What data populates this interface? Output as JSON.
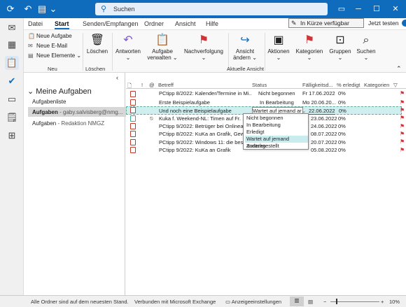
{
  "titlebar": {
    "search_placeholder": "Suchen",
    "accent": "#0f6cbd"
  },
  "menu": {
    "tabs": [
      "Datei",
      "Start",
      "Senden/Empfangen",
      "Ordner",
      "Ansicht",
      "Hilfe"
    ],
    "active": "Start",
    "kurz_label": "In Kürze verfügbar",
    "test_label": "Jetzt testen"
  },
  "ribbon": {
    "neue_aufgabe": "Neue Aufgabe",
    "neue_email": "Neue E-Mail",
    "neue_elemente": "Neue Elemente",
    "group_neu": "Neu",
    "loeschen": "Löschen",
    "group_loeschen": "Löschen",
    "antworten": "Antworten",
    "aufgabe_verwalten_1": "Aufgabe",
    "aufgabe_verwalten_2": "verwalten",
    "nachverfolgung": "Nachverfolgung",
    "ansicht_aendern_1": "Ansicht",
    "ansicht_aendern_2": "ändern",
    "group_aktuelle_ansicht": "Aktuelle Ansicht",
    "aktionen": "Aktionen",
    "kategorien": "Kategorien",
    "gruppen": "Gruppen",
    "suchen": "Suchen"
  },
  "folders": {
    "heading": "Meine Aufgaben",
    "items": [
      {
        "name": "Aufgabenliste",
        "sub": ""
      },
      {
        "name": "Aufgaben",
        "sub": " - gaby.salvisberg@nmg..."
      },
      {
        "name": "Aufgaben",
        "sub": " - Redaktion NMGZ"
      }
    ]
  },
  "table": {
    "headers": {
      "betreff": "Betreff",
      "status": "Status",
      "faellig": "Fälligkeitsd...",
      "erledigt": "% erledigt",
      "kategorien": "Kategorien"
    },
    "rows": [
      {
        "betreff": "PCtipp 8/2022: Kalender/Termine in Mi...",
        "status": "Nicht begonnen",
        "faellig": "Fr 17.06.2022",
        "pct": "0%"
      },
      {
        "betreff": "Erste Beispielaufgabe",
        "status": "In Bearbeitung",
        "faellig": "Mo 20.06.20...",
        "pct": "0%"
      },
      {
        "betreff": "Und noch eine Beispielaufgabe",
        "status": "Wartet auf jemand ar",
        "faellig": "22.06.2022",
        "pct": "0%"
      },
      {
        "betreff": "Kuka f. Weekend-NL: Timen auf Fr. 14",
        "status": "",
        "faellig": "23.06.2022",
        "pct": "0%"
      },
      {
        "betreff": "PCtipp 9/2022: Betrüger bei Onlinean",
        "status": "",
        "faellig": "24.06.2022",
        "pct": "0%"
      },
      {
        "betreff": "PCtipp 8/2022: KuKa an Grafik, Gewin",
        "status": "",
        "faellig": "08.07.2022",
        "pct": "0%"
      },
      {
        "betreff": "PCtipp 9/2022: Windows 11: die beste",
        "status": "",
        "faellig": "20.07.2022",
        "pct": "0%"
      },
      {
        "betreff": "PCtipp 9/2022: KuKa an Grafik",
        "status": "",
        "faellig": "05.08.2022",
        "pct": "0%"
      }
    ],
    "dropdown": [
      "Nicht begonnen",
      "In Bearbeitung",
      "Erledigt",
      "Wartet auf jemand anderen",
      "Zurückgestellt"
    ],
    "dropdown_selected": 3
  },
  "statusbar": {
    "left": "Alle Ordner sind auf dem neuesten Stand.",
    "mid": "Verbunden mit Microsoft Exchange",
    "settings": "Anzeigeeinstellungen",
    "zoom": "10%"
  }
}
